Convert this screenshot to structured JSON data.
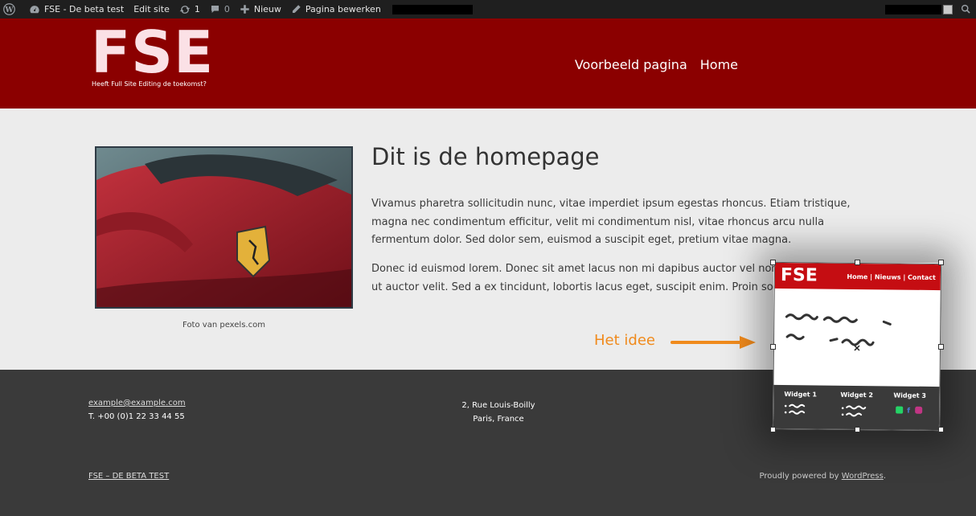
{
  "admin_bar": {
    "site_name": "FSE - De beta test",
    "edit_site": "Edit site",
    "updates_count": "1",
    "comments_count": "0",
    "new_label": "Nieuw",
    "edit_page": "Pagina bewerken",
    "icons": [
      "wordpress-icon",
      "dashboard-icon",
      "updates-icon",
      "comments-icon",
      "plus-icon",
      "pencil-icon",
      "avatar",
      "search-icon"
    ]
  },
  "header": {
    "logo": "FSE",
    "tagline": "Heeft Full Site Editing de toekomst?",
    "nav": [
      "Voorbeeld pagina",
      "Home"
    ],
    "background": "#8b0000"
  },
  "main": {
    "photo_caption": "Foto van pexels.com",
    "title": "Dit is de homepage",
    "paragraphs": [
      "Vivamus pharetra sollicitudin nunc, vitae imperdiet ipsum egestas rhoncus. Etiam tristique, magna nec condimentum efficitur, velit mi condimentum nisl, vitae rhoncus arcu nulla fermentum dolor. Sed dolor sem, euismod a suscipit eget, pretium vitae magna.",
      "Donec id euismod lorem. Donec sit amet lacus non mi dapibus auctor vel non orci. Nam velit, ut auctor velit. Sed a ex tincidunt, lobortis lacus eget, suscipit enim. Proin sodales scelerisque."
    ]
  },
  "footer": {
    "email": "example@example.com",
    "phone": "T. +00 (0)1 22 33 44 55",
    "address_line1": "2, Rue Louis-Boilly",
    "address_line2": "Paris, France",
    "site_link": "FSE – DE BETA TEST",
    "credit_prefix": "Proudly powered by ",
    "credit_link": "WordPress",
    "credit_suffix": ".",
    "background": "#3a3a3a"
  },
  "annotation": {
    "label": "Het idee",
    "color": "#f08a1c"
  },
  "sketch": {
    "logo": "FSE",
    "nav": "Home | Nieuws | Contact",
    "widgets": [
      "Widget 1",
      "Widget 2",
      "Widget 3"
    ],
    "header_color": "#c50d12"
  }
}
